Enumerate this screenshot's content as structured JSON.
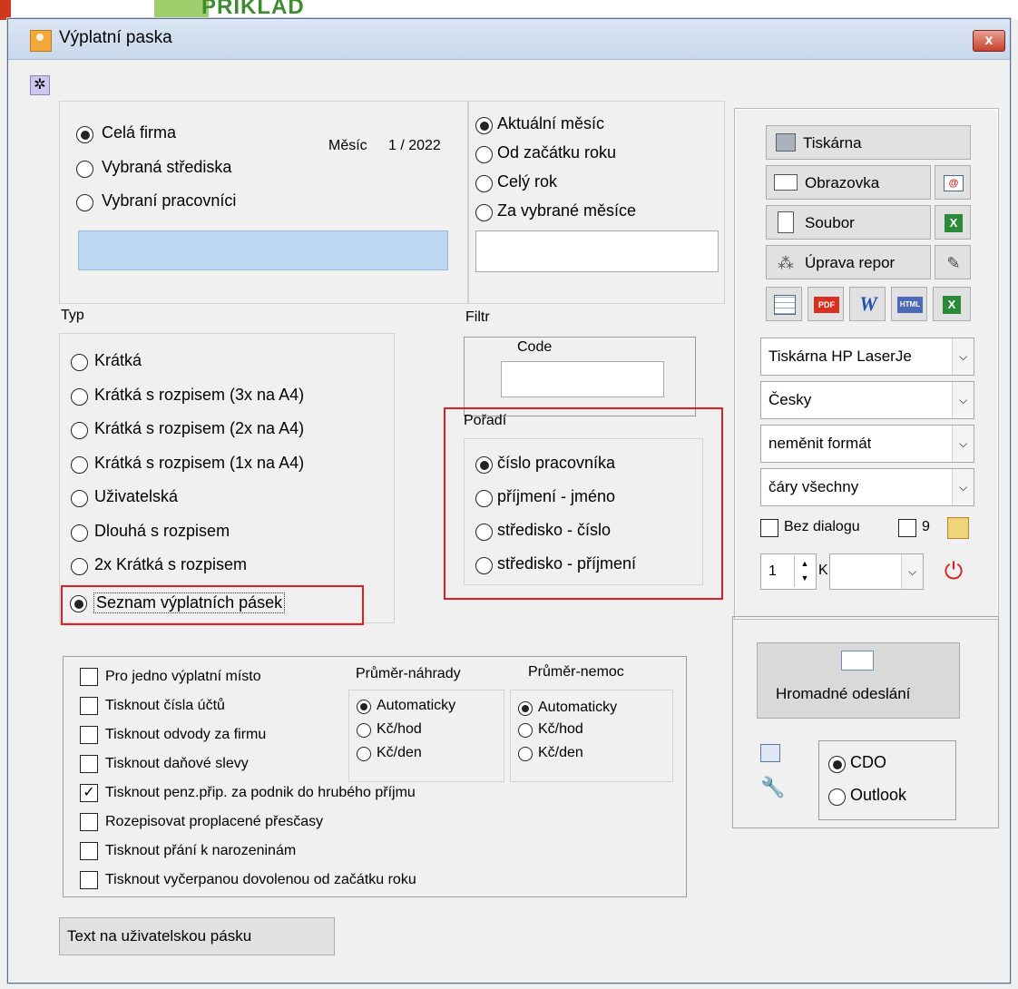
{
  "window": {
    "title": "Výplatní paska",
    "close_label": "x"
  },
  "background": {
    "text": "PRIKLAD"
  },
  "scope": {
    "options": [
      {
        "label": "Celá firma",
        "selected": true
      },
      {
        "label": "Vybraná střediska",
        "selected": false
      },
      {
        "label": "Vybraní pracovníci",
        "selected": false
      }
    ],
    "month_label": "Měsíc",
    "month_value": "1 / 2022"
  },
  "period": {
    "options": [
      {
        "label": "Aktuální měsíc",
        "selected": true
      },
      {
        "label": "Od začátku roku",
        "selected": false
      },
      {
        "label": "Celý rok",
        "selected": false
      },
      {
        "label": "Za vybrané měsíce",
        "selected": false
      }
    ]
  },
  "type": {
    "label": "Typ",
    "options": [
      {
        "label": "Krátká",
        "selected": false
      },
      {
        "label": "Krátká s rozpisem (3x na A4)",
        "selected": false
      },
      {
        "label": "Krátká s rozpisem (2x na A4)",
        "selected": false
      },
      {
        "label": "Krátká s rozpisem (1x na A4)",
        "selected": false
      },
      {
        "label": "Uživatelská",
        "selected": false
      },
      {
        "label": "Dlouhá s rozpisem",
        "selected": false
      },
      {
        "label": "2x Krátká s rozpisem",
        "selected": false
      },
      {
        "label": "Seznam výplatních pásek",
        "selected": true
      }
    ]
  },
  "filter": {
    "label": "Filtr",
    "code_label": "Code",
    "code_value": ""
  },
  "order": {
    "label": "Pořadí",
    "options": [
      {
        "label": "číslo pracovníka",
        "selected": true
      },
      {
        "label": "příjmení - jméno",
        "selected": false
      },
      {
        "label": "středisko - číslo",
        "selected": false
      },
      {
        "label": "středisko - příjmení",
        "selected": false
      }
    ]
  },
  "output": {
    "printer_button": "Tiskárna",
    "screen_button": "Obrazovka",
    "file_button": "Soubor",
    "edit_report_button": "Úprava repor",
    "printer_select": "Tiskárna HP LaserJe",
    "language_select": "Česky",
    "format_select": "neměnit formát",
    "lines_select": "čáry všechny",
    "no_dialog_label": "Bez dialogu",
    "no_dialog_checked": false,
    "nine_label": "9",
    "nine_checked": false,
    "copies_value": "1",
    "copies_suffix": "K",
    "copies_select": "",
    "export_icons": [
      "grid-icon",
      "pdf-icon",
      "word-icon",
      "html-icon",
      "excel-icon"
    ]
  },
  "options": {
    "checks": [
      {
        "label": "Pro jedno výplatní místo",
        "checked": false
      },
      {
        "label": "Tisknout čísla účtů",
        "checked": false
      },
      {
        "label": "Tisknout odvody za firmu",
        "checked": false
      },
      {
        "label": "Tisknout daňové slevy",
        "checked": false
      },
      {
        "label": "Tisknout penz.přip. za podnik do hrubého příjmu",
        "checked": true
      },
      {
        "label": "Rozepisovat proplacené přesčasy",
        "checked": false
      },
      {
        "label": "Tisknout přání k narozeninám",
        "checked": false
      },
      {
        "label": "Tisknout vyčerpanou dovolenou od začátku roku",
        "checked": false
      }
    ],
    "avg_comp_label": "Průměr-náhrady",
    "avg_comp_options": [
      {
        "label": "Automaticky",
        "selected": true
      },
      {
        "label": "Kč/hod",
        "selected": false
      },
      {
        "label": "Kč/den",
        "selected": false
      }
    ],
    "avg_sick_label": "Průměr-nemoc",
    "avg_sick_options": [
      {
        "label": "Automaticky",
        "selected": true
      },
      {
        "label": "Kč/hod",
        "selected": false
      },
      {
        "label": "Kč/den",
        "selected": false
      }
    ]
  },
  "mass_send": {
    "button": "Hromadné odeslání",
    "options": [
      {
        "label": "CDO",
        "selected": true
      },
      {
        "label": "Outlook",
        "selected": false
      }
    ]
  },
  "user_text_button": "Text na uživatelskou pásku"
}
